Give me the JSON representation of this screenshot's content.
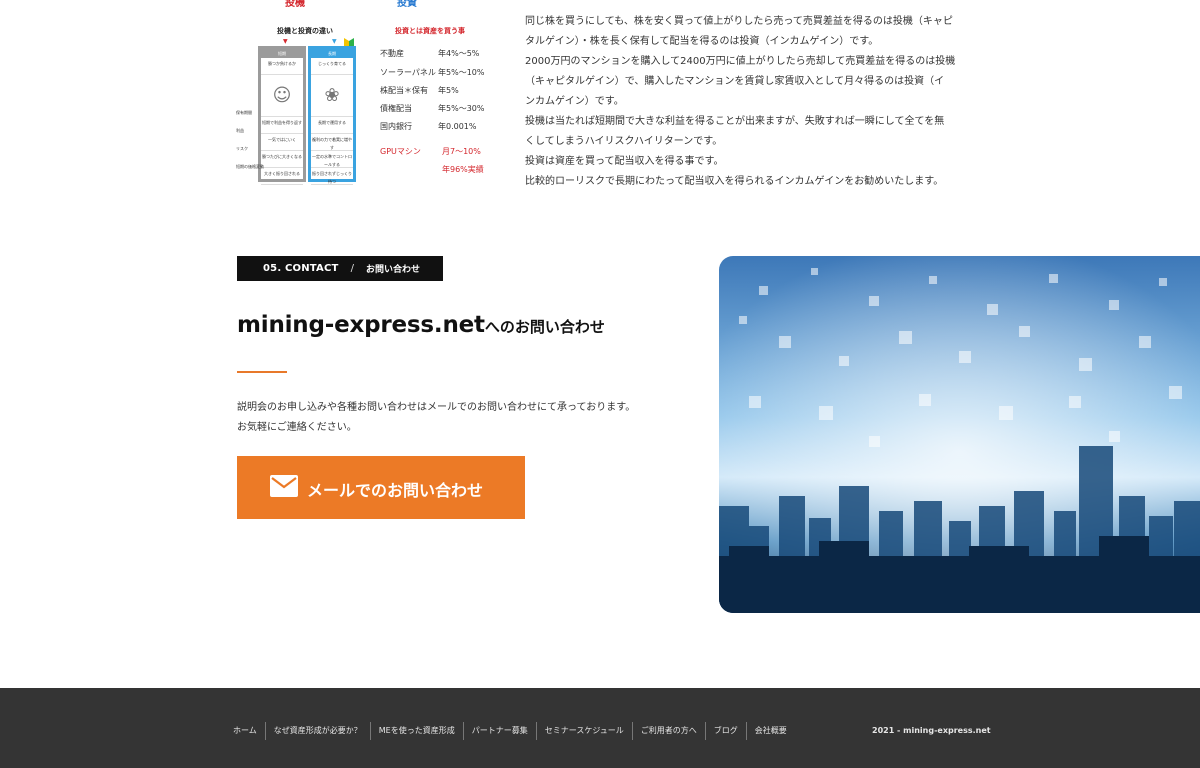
{
  "infographic": {
    "left_title": "投機",
    "right_title": "投資",
    "left_subtitle": "投機と投資の違い",
    "right_subtitle": "投資とは資産を買う事",
    "compare_left_head": "短期",
    "compare_right_head": "長期",
    "compare_left_cells": [
      "勝つか負けるか",
      "短期で利益を得り返す",
      "一気ではにいく",
      "勝つたびに大きくなる",
      "大きく振り回される"
    ],
    "compare_right_cells": [
      "じっくり育てる",
      "長期で運用する",
      "複利の力で着実に増やす",
      "一定の水準でコントロールする",
      "振り回されずじっくり待つ"
    ],
    "row_labels": [
      "保有期間",
      "利益",
      "リスク",
      "短期の価格変動"
    ],
    "yields": [
      {
        "k": "不動産",
        "v": "年4%〜5%"
      },
      {
        "k": "ソーラーパネル",
        "v": "年5%〜10%"
      },
      {
        "k": "株配当＊保有",
        "v": "年5%"
      },
      {
        "k": "債権配当",
        "v": "年5%〜30%"
      },
      {
        "k": "国内銀行",
        "v": "年0.001%"
      }
    ],
    "gpu": {
      "k": "GPUマシン",
      "v": "月7〜10%",
      "note": "年96%実績"
    }
  },
  "intro": [
    "同じ株を買うにしても、株を安く買って値上がりしたら売って売買差益を得るのは投機（キャピ",
    "タルゲイン）・株を長く保有して配当を得るのは投資（インカムゲイン）です。",
    "2000万円のマンションを購入して2400万円に値上がりしたら売却して売買差益を得るのは投機",
    "（キャピタルゲイン）で、購入したマンションを賃貸し家賃収入として月々得るのは投資（イ",
    "ンカムゲイン）です。",
    "投機は当たれば短期間で大きな利益を得ることが出来ますが、失敗すれば一瞬にして全てを無",
    "くしてしまうハイリスクハイリターンです。",
    "投資は資産を買って配当収入を得る事です。",
    "比較的ローリスクで長期にわたって配当収入を得られるインカムゲインをお勧めいたします。"
  ],
  "contact": {
    "badge_en": "05. CONTACT",
    "badge_sep": "/",
    "badge_ja": "お問い合わせ",
    "title_domain": "mining-express.net",
    "title_rest": "へのお問い合わせ",
    "desc_line1": "説明会のお申し込みや各種お問い合わせはメールでのお問い合わせにて承っております。",
    "desc_line2": "お気軽にご連絡ください。",
    "button_label": "メールでのお問い合わせ",
    "button_icon": "envelope-icon"
  },
  "colors": {
    "accent": "#ec7a26",
    "badge_bg": "#111111",
    "footer_bg": "#343434"
  },
  "footer": {
    "links": [
      "ホーム",
      "なぜ資産形成が必要か？",
      "MEを使った資産形成",
      "パートナー募集",
      "セミナースケジュール",
      "ご利用者の方へ",
      "ブログ",
      "会社概要"
    ],
    "copyright": "2021 - mining-express.net"
  }
}
